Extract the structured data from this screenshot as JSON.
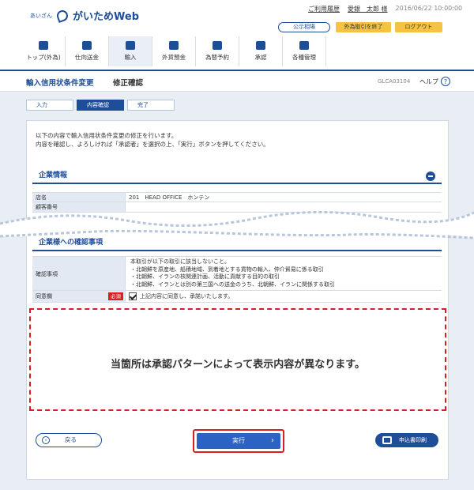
{
  "header": {
    "logo_small": "あいざん",
    "logo_text": "がいためWeb",
    "links": [
      "ご利用履歴",
      "愛銀　太郎 様"
    ],
    "datetime": "2016/06/22 10:00:00",
    "public_rate": "公示相場",
    "fx_end": "外為取引を終了",
    "logout": "ログアウト"
  },
  "nav": {
    "items": [
      {
        "label": "トップ(外為)"
      },
      {
        "label": "仕向送金"
      },
      {
        "label": "輸入"
      },
      {
        "label": "外貨預金"
      },
      {
        "label": "為替予約"
      },
      {
        "label": "承認"
      },
      {
        "label": "各種管理"
      }
    ]
  },
  "title": {
    "main": "輸入信用状条件変更",
    "sub": "修正確認",
    "screen_id": "GLCA03104",
    "help": "ヘルプ"
  },
  "steps": [
    "入力",
    "内容確認",
    "完了"
  ],
  "intro": {
    "line1": "以下の内容で輸入信用状条件変更の修正を行います。",
    "line2": "内容を確認し、よろしければ「承認者」を選択の上、「実行」ボタンを押してください。"
  },
  "company": {
    "heading": "企業情報",
    "rows": [
      {
        "label": "店名",
        "value": "201　HEAD OFFICE　ホンテン"
      },
      {
        "label": "顧客番号",
        "value": ""
      }
    ]
  },
  "confirm": {
    "heading": "企業様への確認事項",
    "item_label": "確認事項",
    "lines": [
      "本取引が以下の取引に該当しないこと。",
      "・北朝鮮を原産地、船積地域、到着地とする貨物の輸入、仲介貿易に係る取引",
      "・北朝鮮、イランの核関連計画、活動に貢献する目的の取引",
      "・北朝鮮、イランとは別の第三国への送金のうち、北朝鮮、イランに関係する取引"
    ],
    "agree_label": "同意欄",
    "required": "必須",
    "agree_text": "上記内容に同意し、承諾いたします。"
  },
  "note": "当箇所は承認パターンによって表示内容が異なります。",
  "buttons": {
    "back": "戻る",
    "exec": "実行",
    "print": "申込書印刷"
  }
}
